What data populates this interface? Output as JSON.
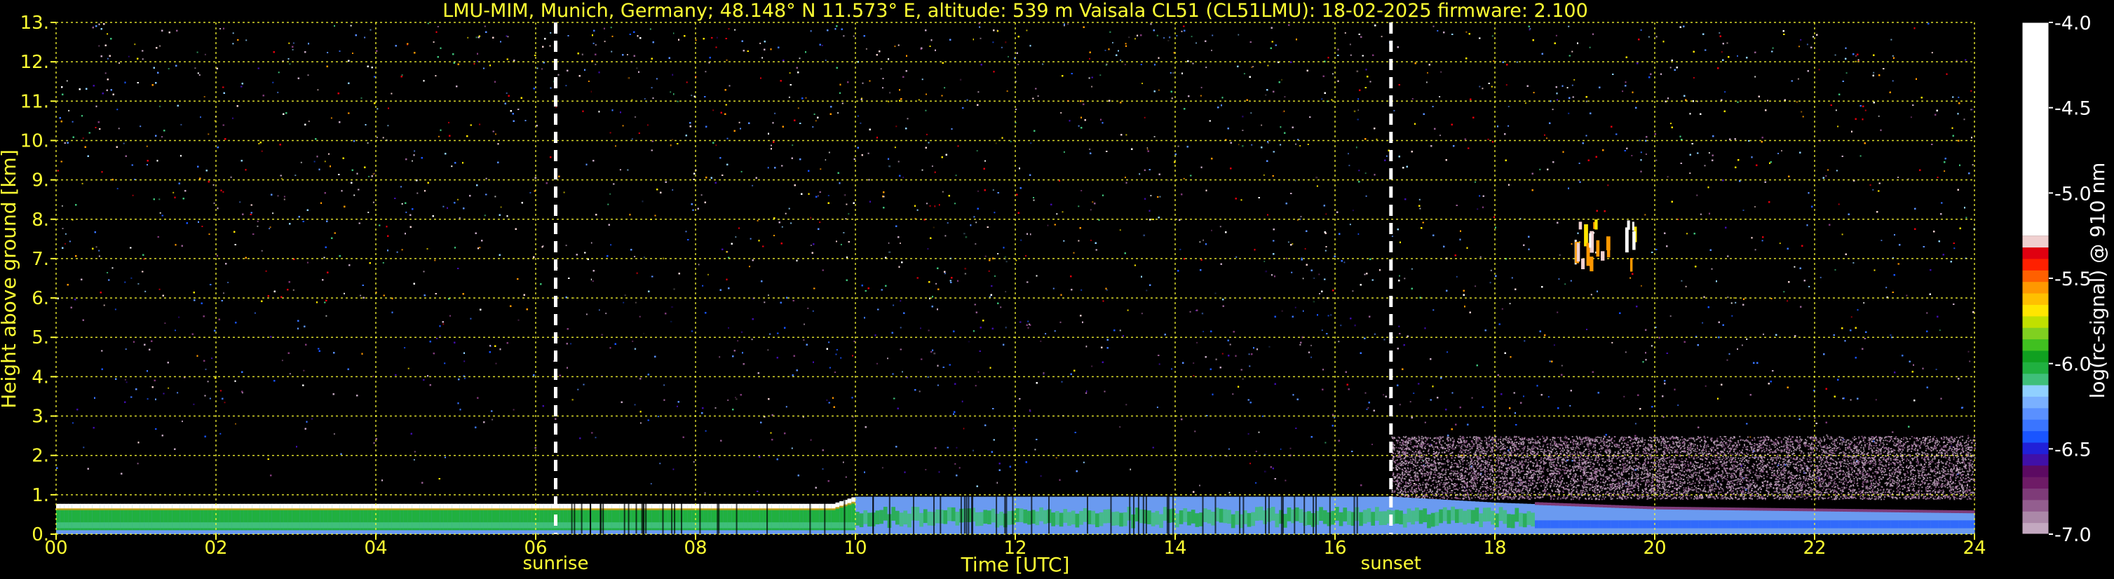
{
  "chart_data": {
    "type": "heatmap",
    "title": "LMU-MIM, Munich, Germany; 48.148° N 11.573° E, altitude: 539 m    Vaisala CL51 (CL51LMU): 18-02-2025    firmware: 2.100",
    "xlabel": "Time [UTC]",
    "ylabel": "Height above ground [km]",
    "xlim": [
      0,
      24
    ],
    "ylim": [
      0,
      13
    ],
    "x_ticks": [
      {
        "value": 0,
        "label": "00"
      },
      {
        "value": 2,
        "label": "02"
      },
      {
        "value": 4,
        "label": "04"
      },
      {
        "value": 6,
        "label": "06"
      },
      {
        "value": 8,
        "label": "08"
      },
      {
        "value": 10,
        "label": "10"
      },
      {
        "value": 12,
        "label": "12"
      },
      {
        "value": 14,
        "label": "14"
      },
      {
        "value": 16,
        "label": "16"
      },
      {
        "value": 18,
        "label": "18"
      },
      {
        "value": 20,
        "label": "20"
      },
      {
        "value": 22,
        "label": "22"
      },
      {
        "value": 24,
        "label": "24"
      }
    ],
    "y_ticks": [
      {
        "value": 0,
        "label": "0."
      },
      {
        "value": 1,
        "label": "1."
      },
      {
        "value": 2,
        "label": "2."
      },
      {
        "value": 3,
        "label": "3."
      },
      {
        "value": 4,
        "label": "4."
      },
      {
        "value": 5,
        "label": "5."
      },
      {
        "value": 6,
        "label": "6."
      },
      {
        "value": 7,
        "label": "7."
      },
      {
        "value": 8,
        "label": "8."
      },
      {
        "value": 9,
        "label": "9."
      },
      {
        "value": 10,
        "label": "10."
      },
      {
        "value": 11,
        "label": "11."
      },
      {
        "value": 12,
        "label": "12."
      },
      {
        "value": 13,
        "label": "13."
      }
    ],
    "grid": true,
    "grid_color": "#ffff33",
    "events": [
      {
        "name": "sunrise",
        "time": 6.25
      },
      {
        "name": "sunset",
        "time": 16.7
      }
    ],
    "colorbar": {
      "label": "log(rc-signal) @ 910 nm",
      "range": [
        -7.0,
        -4.0
      ],
      "ticks": [
        {
          "value": -4.0,
          "label": "-4.0"
        },
        {
          "value": -4.5,
          "label": "-4.5"
        },
        {
          "value": -5.0,
          "label": "-5.0"
        },
        {
          "value": -5.5,
          "label": "-5.5"
        },
        {
          "value": -6.0,
          "label": "-6.0"
        },
        {
          "value": -6.5,
          "label": "-6.5"
        },
        {
          "value": -7.0,
          "label": "-7.0"
        }
      ],
      "colors_bottom_to_top": [
        "#c3a8c0",
        "#ab88a8",
        "#935e8f",
        "#7e3b78",
        "#6e1b66",
        "#5c0a62",
        "#4010a8",
        "#2020d8",
        "#1a55ff",
        "#3a75ff",
        "#5a90ff",
        "#7ab0ff",
        "#90d0ff",
        "#3fbf7a",
        "#20b040",
        "#10a020",
        "#40c020",
        "#80d020",
        "#c0e000",
        "#ffe600",
        "#ffc000",
        "#ff9800",
        "#ff6000",
        "#ff2000",
        "#e00010",
        "#f0d0d0",
        "#ffffff"
      ]
    },
    "layers": [
      {
        "name": "boundary-layer",
        "times": [
          0,
          9.7,
          10,
          16.7,
          18,
          20,
          24
        ],
        "top_km": [
          0.75,
          0.75,
          0.95,
          0.95,
          0.8,
          0.65,
          0.55
        ]
      },
      {
        "name": "cloud-patch",
        "time_range": [
          18.95,
          19.75
        ],
        "height_km": [
          7.0,
          8.0
        ]
      }
    ],
    "colors": {
      "background": "#000000",
      "axis_text": "#ffff33",
      "colorbar_text": "#ffffff",
      "event_line": "#ffffff"
    }
  }
}
